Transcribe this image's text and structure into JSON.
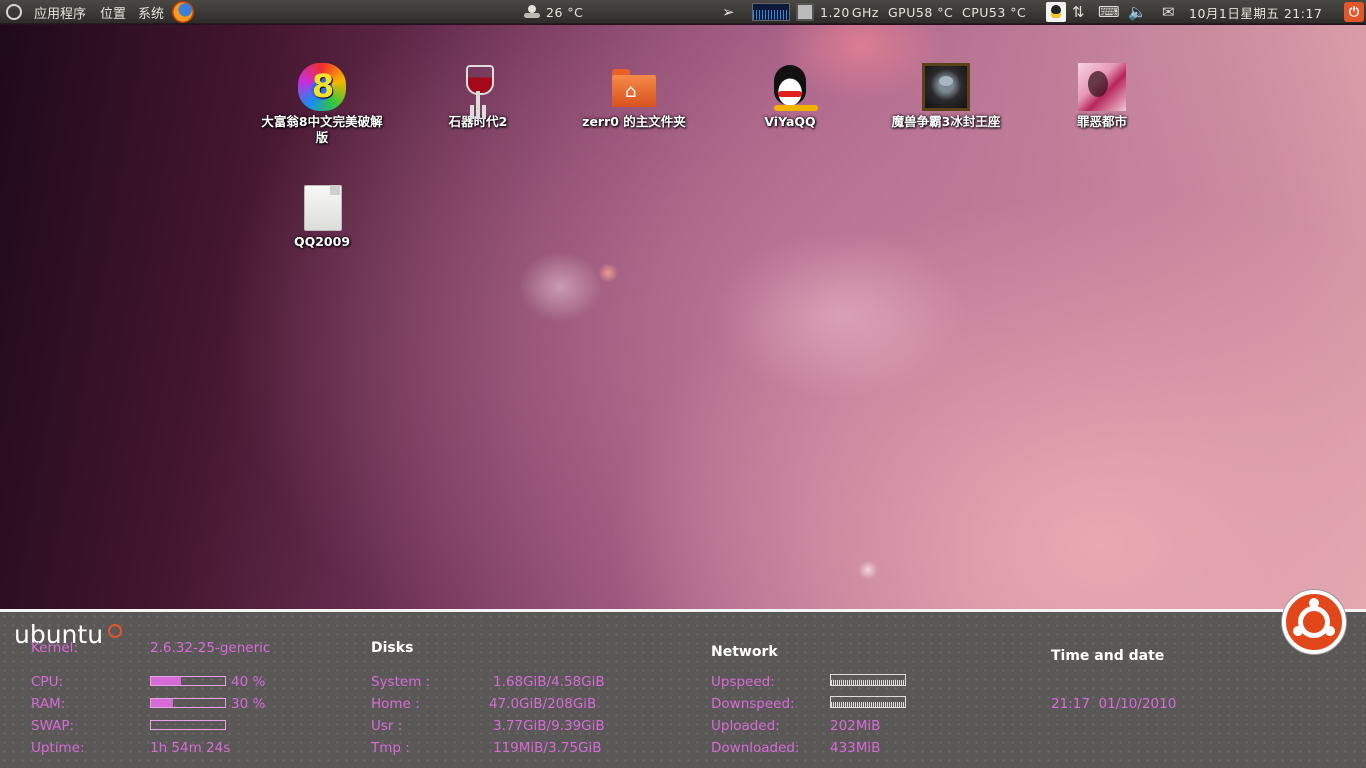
{
  "top_panel": {
    "menus": [
      {
        "label": "应用程序"
      },
      {
        "label": "位置"
      },
      {
        "label": "系统"
      }
    ],
    "weather": "26 °C",
    "cpu_freq": "1.20",
    "cpu_freq_unit": "GHz",
    "gpu_temp": "GPU58 °C",
    "cpu_temp": "CPU53 °C",
    "datetime": "10月1日星期五 21:17",
    "icons": [
      "ubuntu-logo-icon",
      "firefox-icon",
      "weather-icon",
      "switch-user-icon",
      "system-monitor-icon",
      "cpu-chip-icon",
      "qq-tray-icon",
      "network-icon",
      "keyboard-icon",
      "volume-icon",
      "mail-icon",
      "power-icon"
    ]
  },
  "desktop": {
    "icons": [
      {
        "label": "大富翁8中文完美破解\n版",
        "icon": "dafuweng8-icon"
      },
      {
        "label": "石器时代2",
        "icon": "wine-icon"
      },
      {
        "label": "zerr0 的主文件夹",
        "icon": "home-folder-icon"
      },
      {
        "label": "ViYaQQ",
        "icon": "qq-penguin-icon"
      },
      {
        "label": "魔兽争霸3冰封王座",
        "icon": "warcraft3-icon"
      },
      {
        "label": "罪恶都市",
        "icon": "vice-city-icon"
      },
      {
        "label": "QQ2009",
        "icon": "file-icon"
      }
    ]
  },
  "conky": {
    "logo": "ubuntu",
    "system": {
      "kernel_label": "Kernel:",
      "kernel_value": "2.6.32-25-generic",
      "cpu_label": "CPU:",
      "cpu_percent": 40,
      "cpu_text": "40 %",
      "ram_label": "RAM:",
      "ram_percent": 30,
      "ram_text": "30 %",
      "swap_label": "SWAP:",
      "swap_percent": 0,
      "uptime_label": "Uptime:",
      "uptime_value": "1h 54m 24s"
    },
    "disks": {
      "heading": "Disks",
      "rows": [
        {
          "label": "System :",
          "value": "1.68GiB/4.58GiB"
        },
        {
          "label": "Home :",
          "value": "47.0GiB/208GiB"
        },
        {
          "label": "Usr :",
          "value": "3.77GiB/9.39GiB"
        },
        {
          "label": "Tmp :",
          "value": "119MiB/3.75GiB"
        }
      ]
    },
    "network": {
      "heading": "Network",
      "upspeed_label": "Upspeed:",
      "downspeed_label": "Downspeed:",
      "uploaded_label": "Uploaded:",
      "uploaded_value": "202MiB",
      "downloaded_label": "Downloaded:",
      "downloaded_value": "433MiB"
    },
    "time": {
      "heading": "Time and date",
      "value": "21:17  01/10/2010"
    }
  }
}
